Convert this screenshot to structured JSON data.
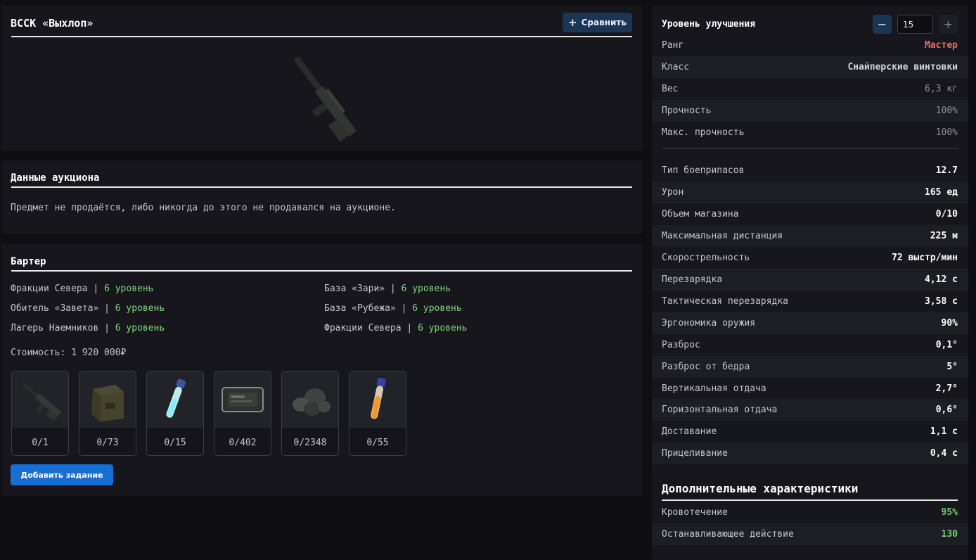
{
  "item": {
    "title": "ВССК «Выхлоп»",
    "compare_label": "Сравнить"
  },
  "auction": {
    "title": "Данные аукциона",
    "text": "Предмет не продаётся, либо никогда до этого не продавался на аукционе."
  },
  "barter": {
    "title": "Бартер",
    "separator": "|",
    "left": [
      {
        "faction": "Фракции Севера",
        "level": "6 уровень"
      },
      {
        "faction": "Обитель «Завета»",
        "level": "6 уровень"
      },
      {
        "faction": "Лагерь Наемников",
        "level": "6 уровень"
      }
    ],
    "right": [
      {
        "faction": "База «Зари»",
        "level": "6 уровень"
      },
      {
        "faction": "База «Рубежа»",
        "level": "6 уровень"
      },
      {
        "faction": "Фракции Севера",
        "level": "6 уровень"
      }
    ],
    "cost": "Стоимость: 1 920 000₽",
    "items": [
      {
        "icon": "rifle-icon",
        "count": "0/1"
      },
      {
        "icon": "ammo-box-icon",
        "count": "0/73"
      },
      {
        "icon": "cyan-vial-icon",
        "count": "0/15"
      },
      {
        "icon": "device-case-icon",
        "count": "0/402"
      },
      {
        "icon": "rocks-icon",
        "count": "0/2348"
      },
      {
        "icon": "orange-vial-icon",
        "count": "0/55"
      }
    ],
    "add_task_label": "Добавить задание"
  },
  "stats": {
    "upgrade_title": "Уровень улучшения",
    "minus_label": "−",
    "plus_label": "+",
    "level_value": "15",
    "rows_top": [
      {
        "label": "Ранг",
        "value": "Мастер"
      },
      {
        "label": "Класс",
        "value": "Снайперские винтовки"
      },
      {
        "label": "Вес",
        "value": "6,3 кг"
      },
      {
        "label": "Прочность",
        "value": "100%"
      },
      {
        "label": "Макс. прочность",
        "value": "100%"
      }
    ],
    "rows_main": [
      {
        "label": "Тип боеприпасов",
        "value": "12.7"
      },
      {
        "label": "Урон",
        "value": "165 ед"
      },
      {
        "label": "Объем магазина",
        "value": "0/10"
      },
      {
        "label": "Максимальная дистанция",
        "value": "225 м"
      },
      {
        "label": "Скорострельность",
        "value": "72 выстр/мин"
      },
      {
        "label": "Перезарядка",
        "value": "4,12 с"
      },
      {
        "label": "Тактическая перезарядка",
        "value": "3,58 с"
      },
      {
        "label": "Эргономика оружия",
        "value": "90%"
      },
      {
        "label": "Разброс",
        "value": "0,1°"
      },
      {
        "label": "Разброс от бедра",
        "value": "5°"
      },
      {
        "label": "Вертикальная отдача",
        "value": "2,7°"
      },
      {
        "label": "Горизонтальная отдача",
        "value": "0,6°"
      },
      {
        "label": "Доставание",
        "value": "1,1 с"
      },
      {
        "label": "Прицеливание",
        "value": "0,4 с"
      }
    ],
    "extra_title": "Дополнительные характеристики",
    "rows_extra": [
      {
        "label": "Кровотечение",
        "value": "95%"
      },
      {
        "label": "Останавливающее действие",
        "value": "130"
      }
    ]
  },
  "colors": {
    "accent_blue": "#1670d4",
    "rank_red": "#e86e6e",
    "level_green": "#7ed67a"
  }
}
